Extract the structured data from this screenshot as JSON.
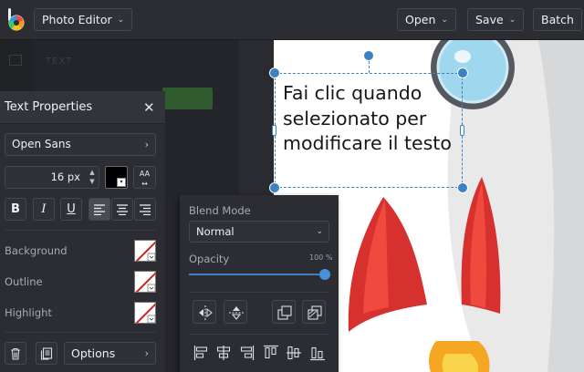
{
  "topbar": {
    "app_name": "Photo Editor",
    "open_label": "Open",
    "save_label": "Save",
    "batch_label": "Batch"
  },
  "background_ui": {
    "tab_text": "TEXT"
  },
  "canvas": {
    "text": "Fai clic quando selezionato per modificare il testo"
  },
  "text_properties": {
    "title": "Text Properties",
    "font": "Open Sans",
    "font_size": "16 px",
    "font_color": "#000000",
    "format_buttons": [
      "B",
      "I",
      "U"
    ],
    "align_active": "left",
    "background_label": "Background",
    "outline_label": "Outline",
    "highlight_label": "Highlight",
    "options_label": "Options"
  },
  "blend": {
    "blend_mode_label": "Blend Mode",
    "blend_mode_value": "Normal",
    "opacity_label": "Opacity",
    "opacity_value": "100 %",
    "opacity_level": 1.0
  },
  "colors": {
    "accent": "#3b82c4",
    "panel": "#2c2d32",
    "topbar": "#2c2d33"
  }
}
